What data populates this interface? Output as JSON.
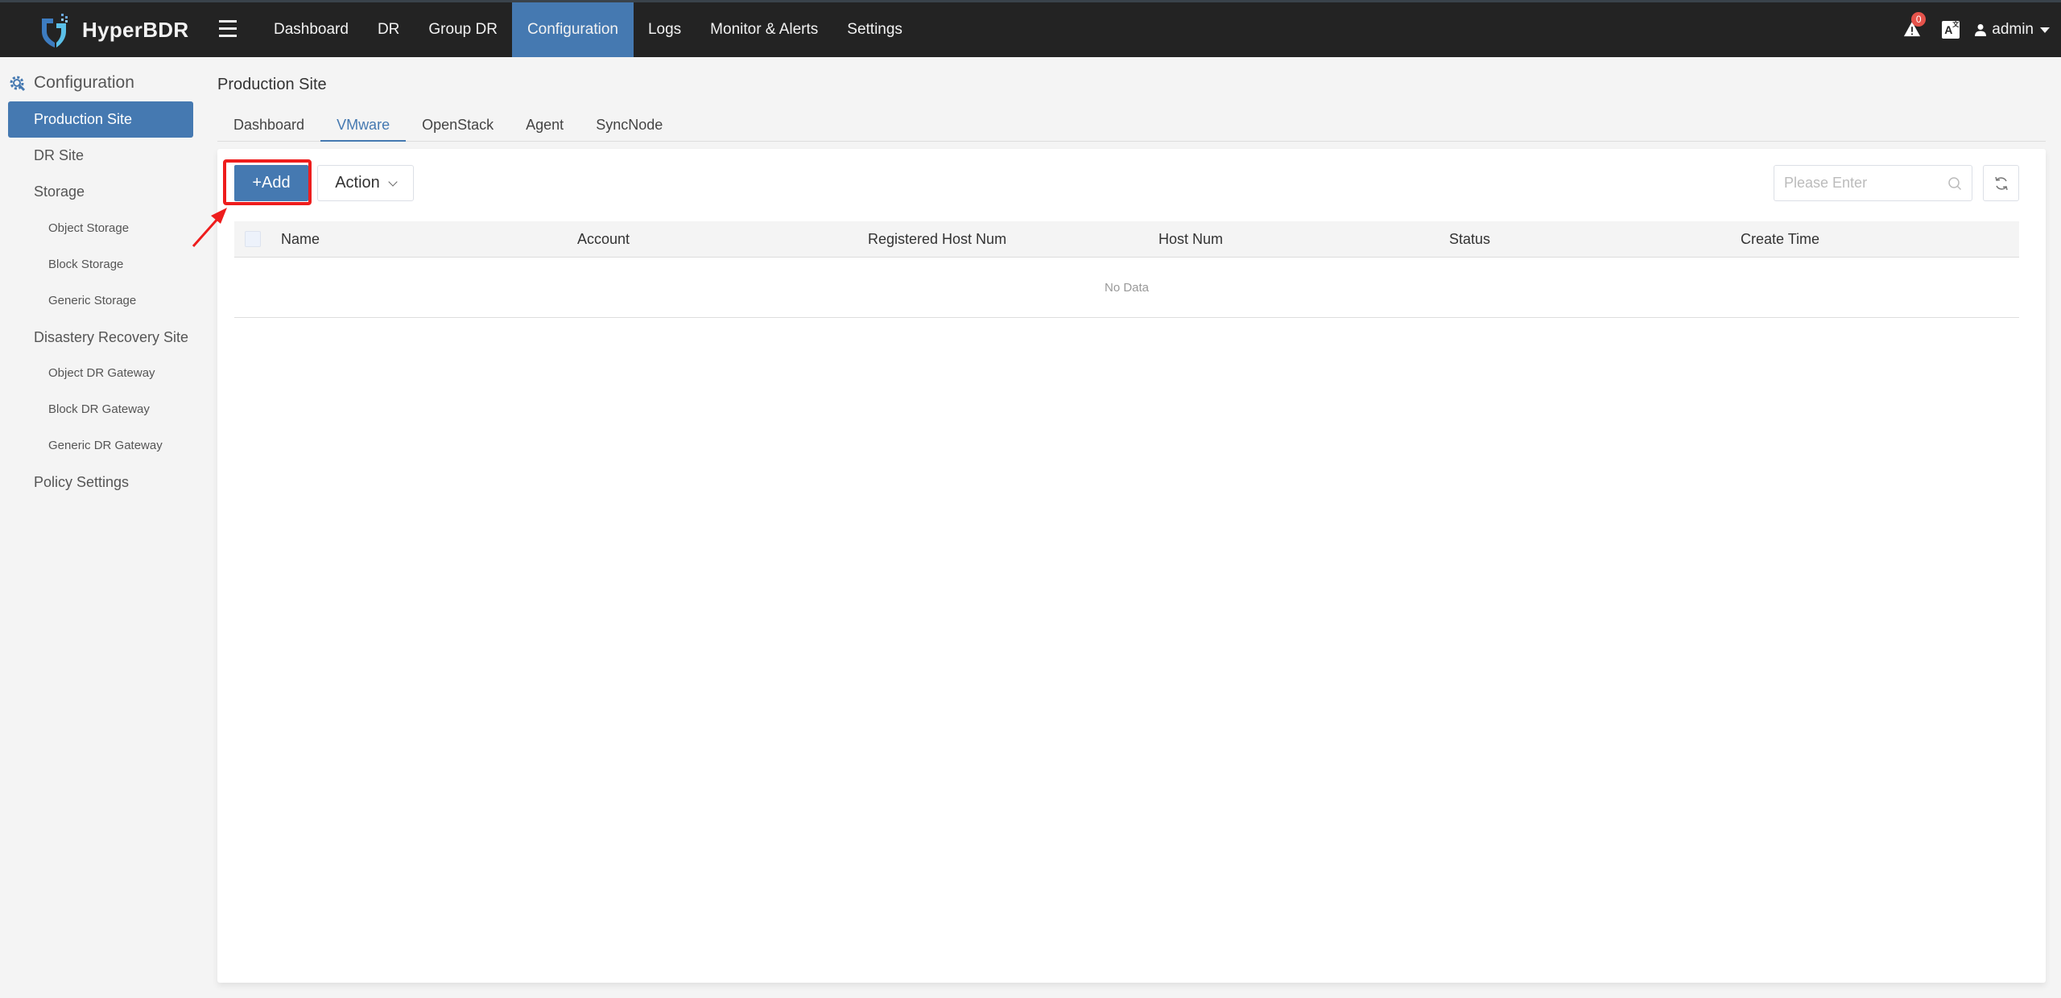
{
  "app": {
    "name": "HyperBDR",
    "brand_color": "#4579b1",
    "highlight_color": "#ee1d1d"
  },
  "topnav": {
    "items": [
      {
        "label": "Dashboard",
        "active": false
      },
      {
        "label": "DR",
        "active": false
      },
      {
        "label": "Group DR",
        "active": false
      },
      {
        "label": "Configuration",
        "active": true
      },
      {
        "label": "Logs",
        "active": false
      },
      {
        "label": "Monitor & Alerts",
        "active": false
      },
      {
        "label": "Settings",
        "active": false
      }
    ],
    "alert_count": "0",
    "language_icon": "translate-icon",
    "user": "admin"
  },
  "sidebar": {
    "title": "Configuration",
    "items": [
      {
        "label": "Production Site",
        "level": 1,
        "active": true
      },
      {
        "label": "DR Site",
        "level": 1
      },
      {
        "label": "Storage",
        "level": 1
      },
      {
        "label": "Object Storage",
        "level": 2
      },
      {
        "label": "Block Storage",
        "level": 2
      },
      {
        "label": "Generic Storage",
        "level": 2
      },
      {
        "label": "Disastery Recovery Site",
        "level": 1
      },
      {
        "label": "Object DR Gateway",
        "level": 2
      },
      {
        "label": "Block DR Gateway",
        "level": 2
      },
      {
        "label": "Generic DR Gateway",
        "level": 2
      },
      {
        "label": "Policy Settings",
        "level": 1
      }
    ]
  },
  "main": {
    "title": "Production Site",
    "tabs": [
      {
        "label": "Dashboard"
      },
      {
        "label": "VMware",
        "active": true
      },
      {
        "label": "OpenStack"
      },
      {
        "label": "Agent"
      },
      {
        "label": "SyncNode"
      }
    ],
    "toolbar": {
      "add_label": "+Add",
      "action_label": "Action",
      "search_placeholder": "Please Enter",
      "search_value": ""
    },
    "table": {
      "columns": [
        "Name",
        "Account",
        "Registered Host Num",
        "Host Num",
        "Status",
        "Create Time"
      ],
      "rows": [],
      "empty_text": "No Data"
    }
  }
}
